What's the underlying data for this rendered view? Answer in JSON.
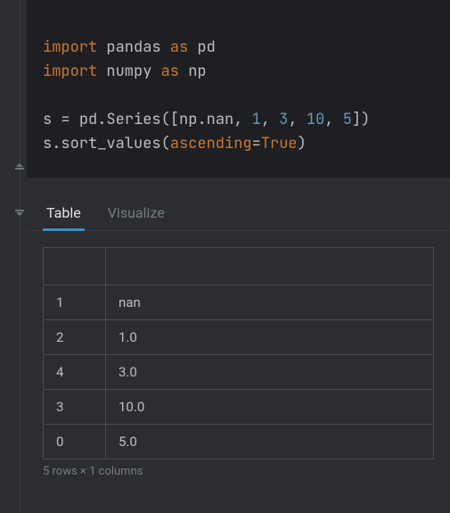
{
  "code": {
    "lines": [
      {
        "tokens": [
          [
            "import ",
            "kw-import"
          ],
          [
            "pandas ",
            "ident"
          ],
          [
            "as ",
            "kw-as"
          ],
          [
            "pd",
            "ident"
          ]
        ]
      },
      {
        "tokens": [
          [
            "import ",
            "kw-import"
          ],
          [
            "numpy ",
            "ident"
          ],
          [
            "as ",
            "kw-as"
          ],
          [
            "np",
            "ident"
          ]
        ]
      },
      {
        "tokens": []
      },
      {
        "tokens": [
          [
            "s ",
            "ident"
          ],
          [
            "= ",
            "eq"
          ],
          [
            "pd",
            "ident"
          ],
          [
            ".",
            "dot"
          ],
          [
            "Series",
            "ident"
          ],
          [
            "(",
            "paren"
          ],
          [
            "[",
            "paren"
          ],
          [
            "np",
            "ident"
          ],
          [
            ".",
            "dot"
          ],
          [
            "nan",
            "ident"
          ],
          [
            ", ",
            "paren"
          ],
          [
            "1",
            "num"
          ],
          [
            ", ",
            "paren"
          ],
          [
            "3",
            "num"
          ],
          [
            ", ",
            "paren"
          ],
          [
            "10",
            "num"
          ],
          [
            ", ",
            "paren"
          ],
          [
            "5",
            "num"
          ],
          [
            "]",
            "paren"
          ],
          [
            ")",
            "paren"
          ]
        ]
      },
      {
        "tokens": [
          [
            "s",
            "ident"
          ],
          [
            ".",
            "dot"
          ],
          [
            "sort_values",
            "ident"
          ],
          [
            "(",
            "paren"
          ],
          [
            "ascending",
            "param"
          ],
          [
            "=",
            "eq"
          ],
          [
            "True",
            "bool"
          ],
          [
            ")",
            "paren"
          ]
        ]
      }
    ]
  },
  "tabs": {
    "items": [
      {
        "label": "Table",
        "active": true
      },
      {
        "label": "Visualize",
        "active": false
      }
    ]
  },
  "table": {
    "headers": [
      "",
      ""
    ],
    "rows": [
      {
        "idx": "1",
        "val": "nan"
      },
      {
        "idx": "2",
        "val": "1.0"
      },
      {
        "idx": "4",
        "val": "3.0"
      },
      {
        "idx": "3",
        "val": "10.0"
      },
      {
        "idx": "0",
        "val": "5.0"
      }
    ],
    "footer": "5 rows × 1 columns"
  }
}
